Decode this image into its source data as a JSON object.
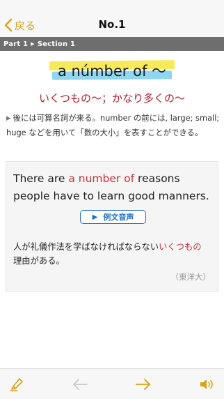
{
  "nav": {
    "back_label": "戻る",
    "title": "No.1"
  },
  "breadcrumb": {
    "part": "Part 1",
    "section": "Section 1"
  },
  "entry": {
    "headword": "a númber of ～",
    "meaning": "いくつもの～；かなり多くの～",
    "note": "後には可算名詞が来る。number の前には, large; small; huge などを用いて「数の大小」を表すことができる。"
  },
  "example": {
    "en_before": "There are ",
    "en_highlight": "a number of",
    "en_after": " reasons people have to learn good manners.",
    "audio_label": "例文音声",
    "ja_before": "人が礼儀作法を学ばなければならない",
    "ja_highlight": "いくつもの",
    "ja_after": "理由がある。",
    "source": "（東洋大）"
  },
  "colors": {
    "accent": "#d9a21b",
    "highlight_red": "#c8323c",
    "link_blue": "#1f6fbf",
    "marker_yellow": "#f6ea5a",
    "marker_blue": "#8fd6f2"
  },
  "icons": {
    "back": "chevron-left-icon",
    "marker": "highlighter-icon",
    "prev": "arrow-left-icon",
    "next": "arrow-right-icon",
    "audio": "speaker-icon"
  },
  "toolbar": {
    "prev_enabled": false,
    "next_enabled": true
  }
}
